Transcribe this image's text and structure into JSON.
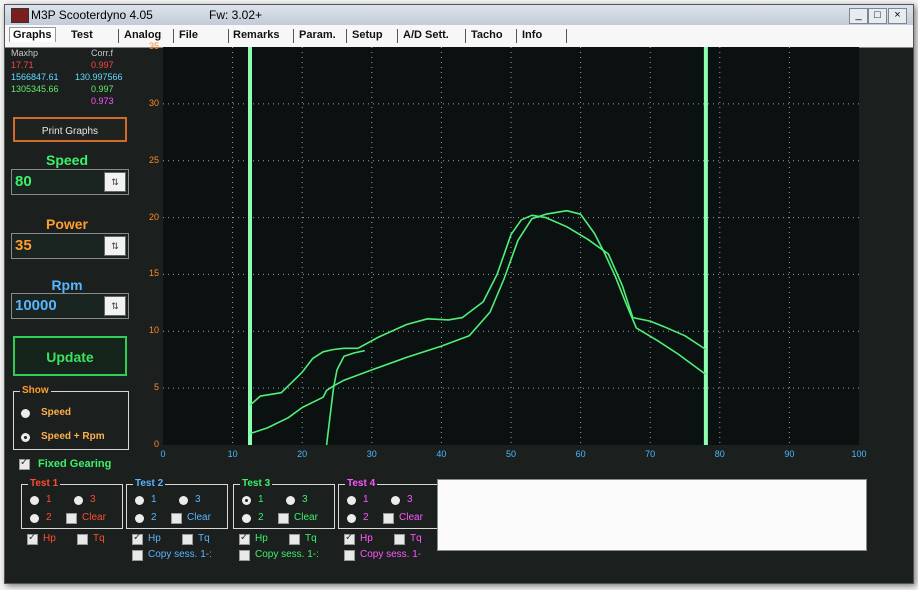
{
  "window": {
    "title": "M3P Scooterdyno 4.05",
    "firmware": "Fw: 3.02+",
    "buttons": {
      "minimize": "_",
      "maximize": "□",
      "close": "×"
    }
  },
  "menu": {
    "tabs": [
      "Graphs",
      "Test",
      "Analog",
      "File",
      "Remarks",
      "Param.",
      "Setup",
      "A/D Sett.",
      "Tacho",
      "Info"
    ]
  },
  "legend": {
    "col1_header": "Maxhp",
    "col2_header": "Corr.f",
    "rows": [
      {
        "maxhp": "17.71",
        "corr": "0.997",
        "color": "#ff4444"
      },
      {
        "maxhp": "1566847.61",
        "corr": "130.997566",
        "color": "#66d8ff"
      },
      {
        "maxhp": "1305345.66",
        "corr": "0.997",
        "color": "#66e870"
      },
      {
        "maxhp": "",
        "corr": "0.973",
        "color": "#ff55ff"
      }
    ]
  },
  "left_panel": {
    "print_button": "Print Graphs",
    "speed_label": "Speed",
    "speed_value": "80",
    "power_label": "Power",
    "power_value": "35",
    "rpm_label": "Rpm",
    "rpm_value": "10000",
    "update_button": "Update",
    "show_group": {
      "title": "Show",
      "options": [
        "Speed",
        "Speed + Rpm"
      ],
      "selected": "Speed + Rpm"
    },
    "fixed_gearing_label": "Fixed Gearing"
  },
  "tests": [
    {
      "title": "Test 1",
      "color": "#ff4d2e",
      "opt1": "1",
      "opt2": "2",
      "opt3": "3",
      "clear": "Clear",
      "hp": "Hp",
      "tq": "Tq",
      "copy": ""
    },
    {
      "title": "Test 2",
      "color": "#5ab4ff",
      "opt1": "1",
      "opt2": "2",
      "opt3": "3",
      "clear": "Clear",
      "hp": "Hp",
      "tq": "Tq",
      "copy": "Copy sess. 1-:"
    },
    {
      "title": "Test 3",
      "color": "#3cf06a",
      "opt1": "1",
      "opt2": "2",
      "opt3": "3",
      "clear": "Clear",
      "hp": "Hp",
      "tq": "Tq",
      "copy": "Copy sess. 1-:"
    },
    {
      "title": "Test 4",
      "color": "#ff55ff",
      "opt1": "1",
      "opt2": "2",
      "opt3": "3",
      "clear": "Clear",
      "hp": "Hp",
      "tq": "Tq",
      "copy": "Copy sess. 1-"
    }
  ],
  "colors": {
    "curve": "#4ef07a",
    "marker_line": "#8dffb0",
    "grid": "#9aa4a0",
    "y_axis": "#ff8a2a",
    "x_axis": "#4ab8ff"
  },
  "chart_data": {
    "type": "line",
    "title": "",
    "xlabel": "",
    "ylabel": "",
    "xlim": [
      0,
      100
    ],
    "ylim": [
      0,
      35
    ],
    "x_ticks": [
      "0",
      "10",
      "20",
      "30",
      "40",
      "50",
      "60",
      "70",
      "80",
      "90",
      "100"
    ],
    "y_ticks": [
      "0",
      "5",
      "10",
      "15",
      "20",
      "25",
      "30",
      "35"
    ],
    "grid": true,
    "markers_x": [
      12.5,
      78
    ],
    "series": [
      {
        "x": [
          12.5,
          14,
          17,
          20,
          21.5,
          23,
          24.5,
          26,
          28,
          31,
          35,
          38,
          41,
          43,
          46,
          48,
          50,
          51.5,
          53,
          55,
          58,
          61,
          64,
          66,
          67.5,
          70,
          72,
          75,
          78
        ],
        "values": [
          3.5,
          4.3,
          4.6,
          6.4,
          7.6,
          8.2,
          8.4,
          8.5,
          8.5,
          9.5,
          10.6,
          11.1,
          11.0,
          11.2,
          12.6,
          15.0,
          18.5,
          19.8,
          20.2,
          20.0,
          19.2,
          18.1,
          16.8,
          14.0,
          11.2,
          10.9,
          10.4,
          9.6,
          8.4
        ]
      },
      {
        "x": [
          12.5,
          15,
          18,
          20,
          22,
          23,
          23.5,
          24.5,
          26,
          30,
          35,
          40,
          44,
          47,
          49,
          51,
          53,
          55,
          58,
          60,
          62,
          63.5,
          65,
          66.5,
          68,
          71,
          74,
          78
        ],
        "values": [
          1.0,
          1.5,
          2.4,
          3.3,
          3.9,
          4.2,
          4.8,
          5.2,
          5.7,
          6.6,
          7.7,
          8.7,
          9.6,
          11.7,
          14.6,
          18.0,
          19.9,
          20.3,
          20.6,
          20.3,
          18.6,
          16.8,
          14.8,
          12.5,
          10.3,
          9.2,
          8.0,
          6.2
        ]
      },
      {
        "x": [
          23.5,
          24,
          24.5,
          25,
          26,
          27.5,
          29
        ],
        "values": [
          0,
          2.5,
          5.0,
          6.6,
          7.8,
          8.1,
          8.3
        ]
      }
    ]
  }
}
